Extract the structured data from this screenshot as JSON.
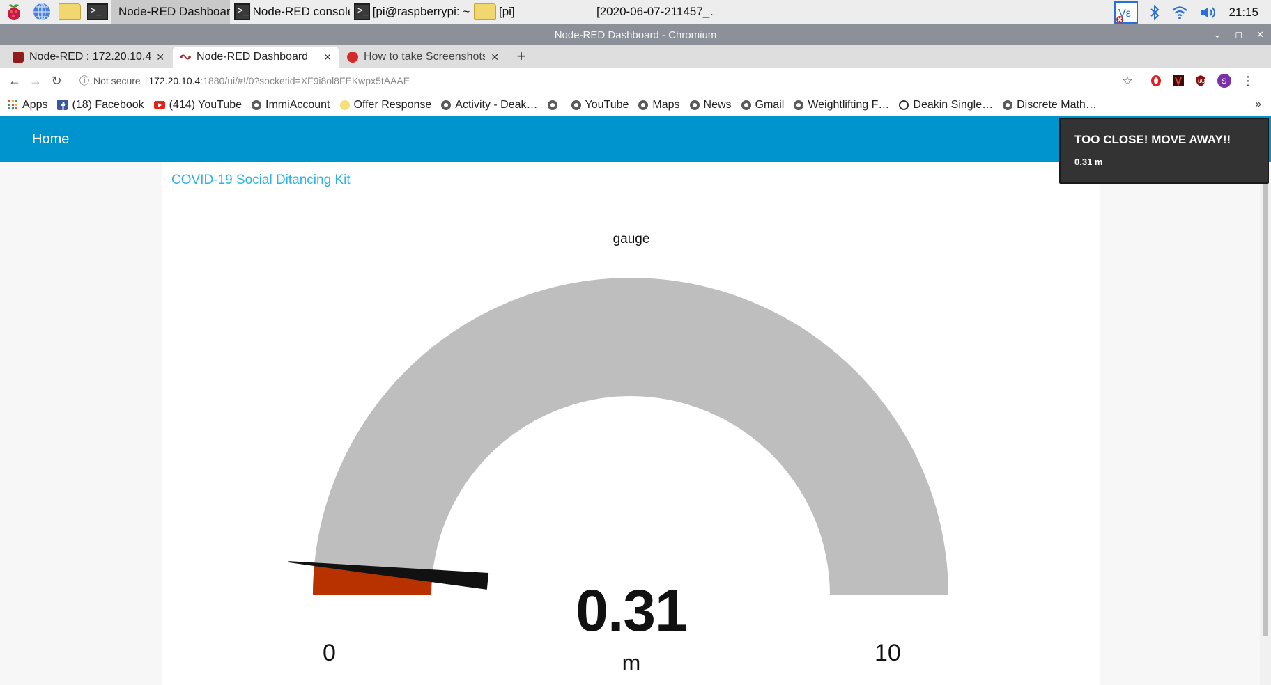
{
  "taskbar": {
    "tasks": [
      {
        "label": "Node-RED Dashboar…",
        "active": true
      },
      {
        "label": "Node-RED console",
        "active": false
      },
      {
        "label": "[pi@raspberrypi: ~]",
        "active": false
      },
      {
        "label": "[pi]",
        "active": false
      },
      {
        "label": "[2020-06-07-211457_…",
        "active": false
      }
    ],
    "clock": "21:15"
  },
  "window": {
    "title": "Node-RED Dashboard - Chromium"
  },
  "tabs": [
    {
      "title": "Node-RED : 172.20.10.4",
      "favicon_color": "#8f1b1b",
      "active": false
    },
    {
      "title": "Node-RED Dashboard",
      "favicon_color": "#a32828",
      "active": true
    },
    {
      "title": "How to take Screenshots",
      "favicon_color": "#d42a2a",
      "active": false
    }
  ],
  "omnibox": {
    "security": "Not secure",
    "host": "172.20.10.4",
    "path": ":1880/ui/#!/0?socketid=XF9i8ol8FEKwpx5tAAAE"
  },
  "bookmarks": [
    {
      "label": "Apps",
      "icon": "apps-grid-icon"
    },
    {
      "label": "(18) Facebook",
      "icon": "facebook-icon"
    },
    {
      "label": "(414) YouTube",
      "icon": "youtube-icon"
    },
    {
      "label": "ImmiAccount",
      "icon": "globe-icon"
    },
    {
      "label": "Offer Response",
      "icon": "star-bookmark-icon"
    },
    {
      "label": "Activity - Deak…",
      "icon": "globe-icon"
    },
    {
      "label": "",
      "icon": "globe-icon"
    },
    {
      "label": "YouTube",
      "icon": "globe-icon"
    },
    {
      "label": "Maps",
      "icon": "globe-icon"
    },
    {
      "label": "News",
      "icon": "globe-icon"
    },
    {
      "label": "Gmail",
      "icon": "globe-icon"
    },
    {
      "label": "Weightlifting F…",
      "icon": "globe-icon"
    },
    {
      "label": "Deakin Single…",
      "icon": "deakin-icon"
    },
    {
      "label": "Discrete Math…",
      "icon": "globe-icon"
    }
  ],
  "dashboard": {
    "header_title": "Home",
    "group_title": "COVID-19 Social Ditancing Kit",
    "gauge": {
      "label": "gauge",
      "value": "0.31",
      "units": "m",
      "min": "0",
      "max": "10",
      "fraction": 0.031,
      "fill_color": "#b83200",
      "track_color": "#bebebe"
    }
  },
  "toast": {
    "title": "TOO CLOSE! MOVE AWAY!!",
    "message": "0.31 m"
  },
  "colors": {
    "header": "#0094ce",
    "accent_text": "#2cb3e6"
  }
}
